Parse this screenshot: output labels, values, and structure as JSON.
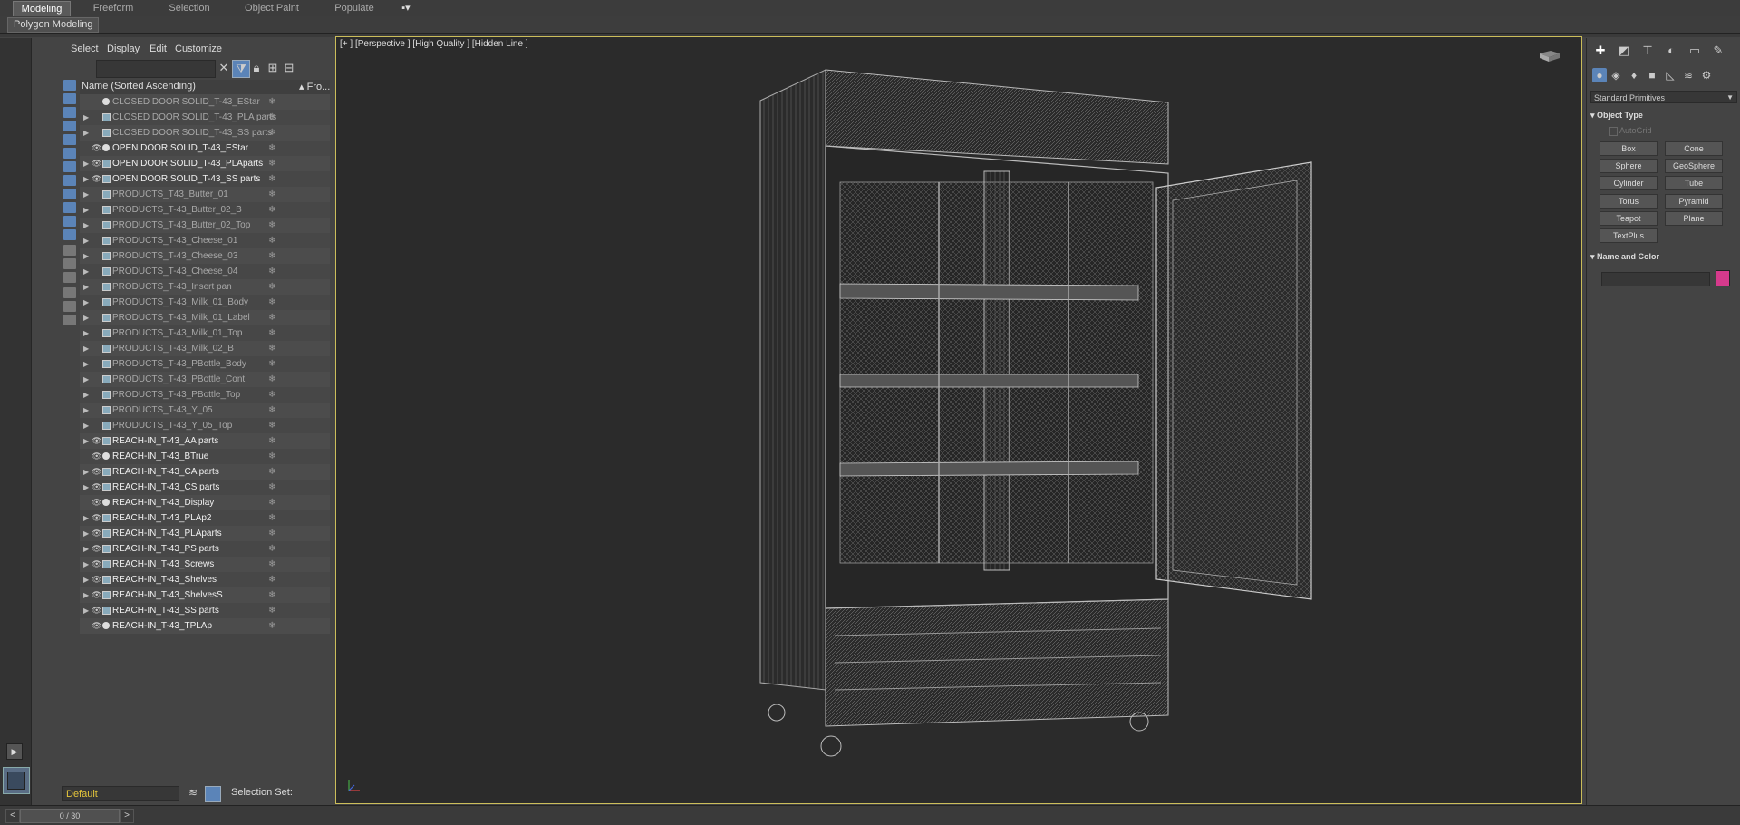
{
  "ribbon": {
    "tabs": [
      "Modeling",
      "Freeform",
      "Selection",
      "Object Paint",
      "Populate"
    ],
    "active_tab": "Modeling",
    "toggle_label": "▪▾",
    "sub_label": "Polygon Modeling"
  },
  "scene_explorer": {
    "menu": [
      "Select",
      "Display",
      "Edit",
      "Customize"
    ],
    "column_name": "Name (Sorted Ascending)",
    "column_frozen": "▴ Fro...",
    "rows": [
      {
        "label": "CLOSED DOOR SOLID_T-43_EStar",
        "expand": false,
        "eye": false,
        "type": "sphere",
        "style": "dim"
      },
      {
        "label": "CLOSED DOOR SOLID_T-43_PLA parts",
        "expand": true,
        "eye": false,
        "type": "layer",
        "style": "dim"
      },
      {
        "label": "CLOSED DOOR SOLID_T-43_SS parts",
        "expand": true,
        "eye": false,
        "type": "layer",
        "style": "dim"
      },
      {
        "label": "OPEN DOOR SOLID_T-43_EStar",
        "expand": false,
        "eye": true,
        "type": "sphere",
        "style": "bright"
      },
      {
        "label": "OPEN DOOR SOLID_T-43_PLAparts",
        "expand": true,
        "eye": true,
        "type": "layer",
        "style": "bright"
      },
      {
        "label": "OPEN DOOR SOLID_T-43_SS parts",
        "expand": true,
        "eye": true,
        "type": "layer",
        "style": "bright"
      },
      {
        "label": "PRODUCTS_T43_Butter_01",
        "expand": true,
        "eye": false,
        "type": "layer",
        "style": "dim"
      },
      {
        "label": "PRODUCTS_T-43_Butter_02_B",
        "expand": true,
        "eye": false,
        "type": "layer",
        "style": "dim"
      },
      {
        "label": "PRODUCTS_T-43_Butter_02_Top",
        "expand": true,
        "eye": false,
        "type": "layer",
        "style": "dim"
      },
      {
        "label": "PRODUCTS_T-43_Cheese_01",
        "expand": true,
        "eye": false,
        "type": "layer",
        "style": "dim"
      },
      {
        "label": "PRODUCTS_T-43_Cheese_03",
        "expand": true,
        "eye": false,
        "type": "layer",
        "style": "dim"
      },
      {
        "label": "PRODUCTS_T-43_Cheese_04",
        "expand": true,
        "eye": false,
        "type": "layer",
        "style": "dim"
      },
      {
        "label": "PRODUCTS_T-43_Insert pan",
        "expand": true,
        "eye": false,
        "type": "layer",
        "style": "dim"
      },
      {
        "label": "PRODUCTS_T-43_Milk_01_Body",
        "expand": true,
        "eye": false,
        "type": "layer",
        "style": "dim"
      },
      {
        "label": "PRODUCTS_T-43_Milk_01_Label",
        "expand": true,
        "eye": false,
        "type": "layer",
        "style": "dim"
      },
      {
        "label": "PRODUCTS_T-43_Milk_01_Top",
        "expand": true,
        "eye": false,
        "type": "layer",
        "style": "dim"
      },
      {
        "label": "PRODUCTS_T-43_Milk_02_B",
        "expand": true,
        "eye": false,
        "type": "layer",
        "style": "dim"
      },
      {
        "label": "PRODUCTS_T-43_PBottle_Body",
        "expand": true,
        "eye": false,
        "type": "layer",
        "style": "dim"
      },
      {
        "label": "PRODUCTS_T-43_PBottle_Cont",
        "expand": true,
        "eye": false,
        "type": "layer",
        "style": "dim"
      },
      {
        "label": "PRODUCTS_T-43_PBottle_Top",
        "expand": true,
        "eye": false,
        "type": "layer",
        "style": "dim"
      },
      {
        "label": "PRODUCTS_T-43_Y_05",
        "expand": true,
        "eye": false,
        "type": "layer",
        "style": "dim"
      },
      {
        "label": "PRODUCTS_T-43_Y_05_Top",
        "expand": true,
        "eye": false,
        "type": "layer",
        "style": "dim"
      },
      {
        "label": "REACH-IN_T-43_AA parts",
        "expand": true,
        "eye": true,
        "type": "layer",
        "style": "bright"
      },
      {
        "label": "REACH-IN_T-43_BTrue",
        "expand": false,
        "eye": true,
        "type": "sphere",
        "style": "bright"
      },
      {
        "label": "REACH-IN_T-43_CA parts",
        "expand": true,
        "eye": true,
        "type": "layer",
        "style": "bright"
      },
      {
        "label": "REACH-IN_T-43_CS parts",
        "expand": true,
        "eye": true,
        "type": "layer",
        "style": "bright"
      },
      {
        "label": "REACH-IN_T-43_Display",
        "expand": false,
        "eye": true,
        "type": "sphere",
        "style": "bright"
      },
      {
        "label": "REACH-IN_T-43_PLAp2",
        "expand": true,
        "eye": true,
        "type": "layer",
        "style": "bright"
      },
      {
        "label": "REACH-IN_T-43_PLAparts",
        "expand": true,
        "eye": true,
        "type": "layer",
        "style": "bright"
      },
      {
        "label": "REACH-IN_T-43_PS parts",
        "expand": true,
        "eye": true,
        "type": "layer",
        "style": "bright"
      },
      {
        "label": "REACH-IN_T-43_Screws",
        "expand": true,
        "eye": true,
        "type": "layer",
        "style": "bright"
      },
      {
        "label": "REACH-IN_T-43_Shelves",
        "expand": true,
        "eye": true,
        "type": "layer",
        "style": "bright"
      },
      {
        "label": "REACH-IN_T-43_ShelvesS",
        "expand": true,
        "eye": true,
        "type": "layer",
        "style": "bright"
      },
      {
        "label": "REACH-IN_T-43_SS parts",
        "expand": true,
        "eye": true,
        "type": "layer",
        "style": "bright"
      },
      {
        "label": "REACH-IN_T-43_TPLAp",
        "expand": false,
        "eye": true,
        "type": "sphere",
        "style": "bright"
      }
    ],
    "layer_value": "Default",
    "selection_set_label": "Selection Set:"
  },
  "viewport": {
    "label": "[+ ]  [Perspective ]  [High Quality ]  [Hidden Line ]",
    "border_color": "#cbbd5a"
  },
  "command_panel": {
    "category": "Standard Primitives",
    "object_type_title": "Object Type",
    "autogrid_label": "AutoGrid",
    "primitives": [
      "Box",
      "Cone",
      "Sphere",
      "GeoSphere",
      "Cylinder",
      "Tube",
      "Torus",
      "Pyramid",
      "Teapot",
      "Plane",
      "TextPlus"
    ],
    "name_color_title": "Name and Color",
    "object_color": "#d63a8c"
  },
  "timeline": {
    "frame_display": "0 / 30"
  },
  "colors": {
    "accent_blue": "#5b84b8",
    "active_viewport_border": "#cbbd5a",
    "layer_name_text": "#e4c53b"
  }
}
